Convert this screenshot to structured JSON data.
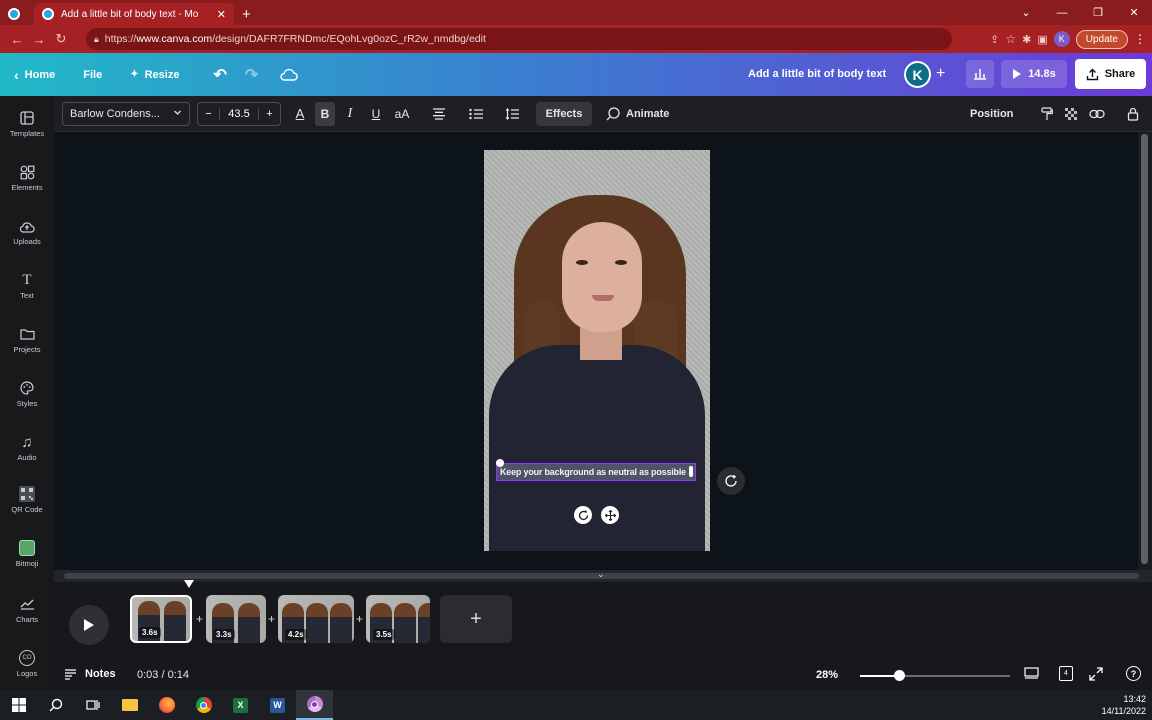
{
  "browser": {
    "tab_title": "Add a little bit of body text - Mo",
    "url_prefix": "https://",
    "url_host": "www.canva.com",
    "url_path": "/design/DAFR7FRNDmc/EQohLvg0ozC_rR2w_nmdbg/edit",
    "update_label": "Update",
    "profile_initial": "K"
  },
  "header": {
    "home_label": "Home",
    "file_label": "File",
    "resize_label": "Resize",
    "doc_title": "Add a little bit of body text",
    "user_initial": "K",
    "play_duration": "14.8s",
    "share_label": "Share"
  },
  "rail": [
    {
      "label": "Templates",
      "icon": "templates-icon"
    },
    {
      "label": "Elements",
      "icon": "elements-icon"
    },
    {
      "label": "Uploads",
      "icon": "upload-cloud-icon"
    },
    {
      "label": "Text",
      "icon": "text-icon"
    },
    {
      "label": "Projects",
      "icon": "folder-icon"
    },
    {
      "label": "Styles",
      "icon": "palette-icon"
    },
    {
      "label": "Audio",
      "icon": "music-note-icon"
    },
    {
      "label": "QR Code",
      "icon": "qr-code-icon"
    },
    {
      "label": "Bitmoji",
      "icon": "bitmoji-icon"
    },
    {
      "label": "Charts",
      "icon": "chart-icon"
    },
    {
      "label": "Logos",
      "icon": "logos-icon"
    }
  ],
  "toolbar": {
    "font_name": "Barlow Condens...",
    "font_size": "43.5",
    "minus": "−",
    "plus": "+",
    "effects_label": "Effects",
    "animate_label": "Animate",
    "position_label": "Position"
  },
  "canvas": {
    "text_content": "Keep your background as neutral as possible"
  },
  "timeline": {
    "clips": [
      {
        "duration": "3.6s"
      },
      {
        "duration": "3.3s"
      },
      {
        "duration": "4.2s"
      },
      {
        "duration": "3.5s"
      }
    ],
    "add_label": "+"
  },
  "footer": {
    "notes_label": "Notes",
    "timecode": "0:03 / 0:14",
    "zoom": "28%",
    "page_count": "4",
    "zoom_level": 0.28
  },
  "taskbar": {
    "time": "13:42",
    "date": "14/11/2022"
  },
  "colors": {
    "tabbar": "#8a1c1e",
    "header_start": "#21b9c7",
    "header_end": "#6d3ad7",
    "selection": "#8b3dff"
  }
}
